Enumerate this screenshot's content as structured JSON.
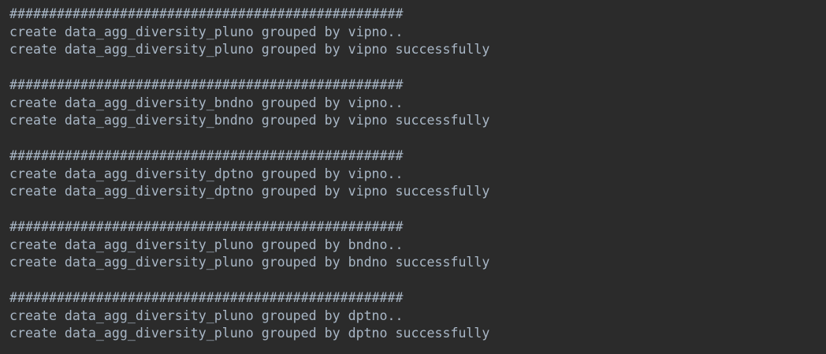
{
  "console": {
    "blocks": [
      {
        "separator": "##################################################",
        "start": "create data_agg_diversity_pluno grouped by vipno..",
        "done": "create data_agg_diversity_pluno grouped by vipno successfully"
      },
      {
        "separator": "##################################################",
        "start": "create data_agg_diversity_bndno grouped by vipno..",
        "done": "create data_agg_diversity_bndno grouped by vipno successfully"
      },
      {
        "separator": "##################################################",
        "start": "create data_agg_diversity_dptno grouped by vipno..",
        "done": "create data_agg_diversity_dptno grouped by vipno successfully"
      },
      {
        "separator": "##################################################",
        "start": "create data_agg_diversity_pluno grouped by bndno..",
        "done": "create data_agg_diversity_pluno grouped by bndno successfully"
      },
      {
        "separator": "##################################################",
        "start": "create data_agg_diversity_pluno grouped by dptno..",
        "done": "create data_agg_diversity_pluno grouped by dptno successfully"
      }
    ]
  },
  "colors": {
    "background": "#2b2b2b",
    "text": "#a9b7c6"
  }
}
